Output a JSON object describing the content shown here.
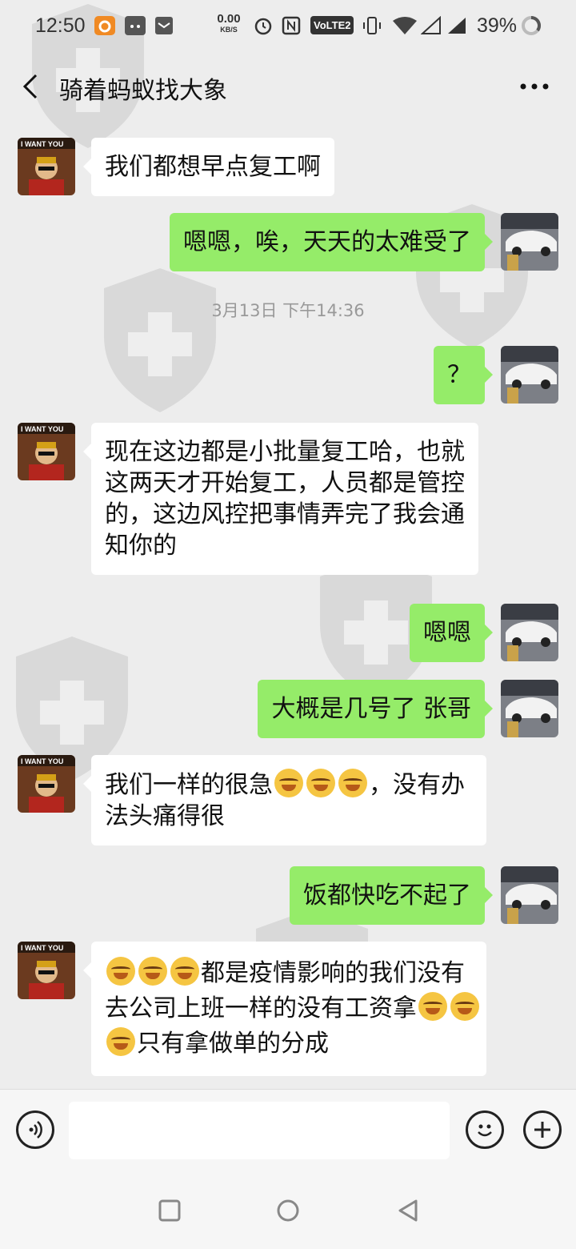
{
  "status_bar": {
    "time": "12:50",
    "net_speed": "0.00",
    "net_unit": "KB/S",
    "volte": "VoLTE2",
    "battery": "39%"
  },
  "header": {
    "back_icon": "chevron-left-icon",
    "title": "骑着蚂蚁找大象",
    "more_icon": "more-dots-icon"
  },
  "messages": [
    {
      "side": "left",
      "text": "我们都想早点复工啊"
    },
    {
      "side": "right",
      "text": "嗯嗯，唉，天天的太难受了"
    },
    {
      "side": "right",
      "text": "？"
    },
    {
      "side": "left",
      "lines": [
        "现在这边都是小批量复工哈，也就",
        "这两天才开始复工，人员都是管控",
        "的，这边风控把事情弄完了我会通",
        "知你的"
      ]
    },
    {
      "side": "right",
      "text": "嗯嗯"
    },
    {
      "side": "right",
      "text": "大概是几号了 张哥"
    },
    {
      "side": "left",
      "line1_a": "我们一样的很急",
      "line1_b": "，没有办",
      "line2": "法头痛得很"
    },
    {
      "side": "right",
      "text": "饭都快吃不起了"
    },
    {
      "side": "left",
      "line1": "都是疫情影响的我们没有",
      "line2": "去公司上班一样的没有工资拿",
      "line3": "只有拿做单的分成"
    }
  ],
  "timestamp": "3月13日 下午14:36",
  "input_bar": {
    "voice_icon": "voice-icon",
    "emoji_icon": "emoji-icon",
    "plus_icon": "plus-icon",
    "placeholder": ""
  },
  "colors": {
    "background": "#ededed",
    "sent_bubble": "#95ec69",
    "received_bubble": "#ffffff"
  }
}
